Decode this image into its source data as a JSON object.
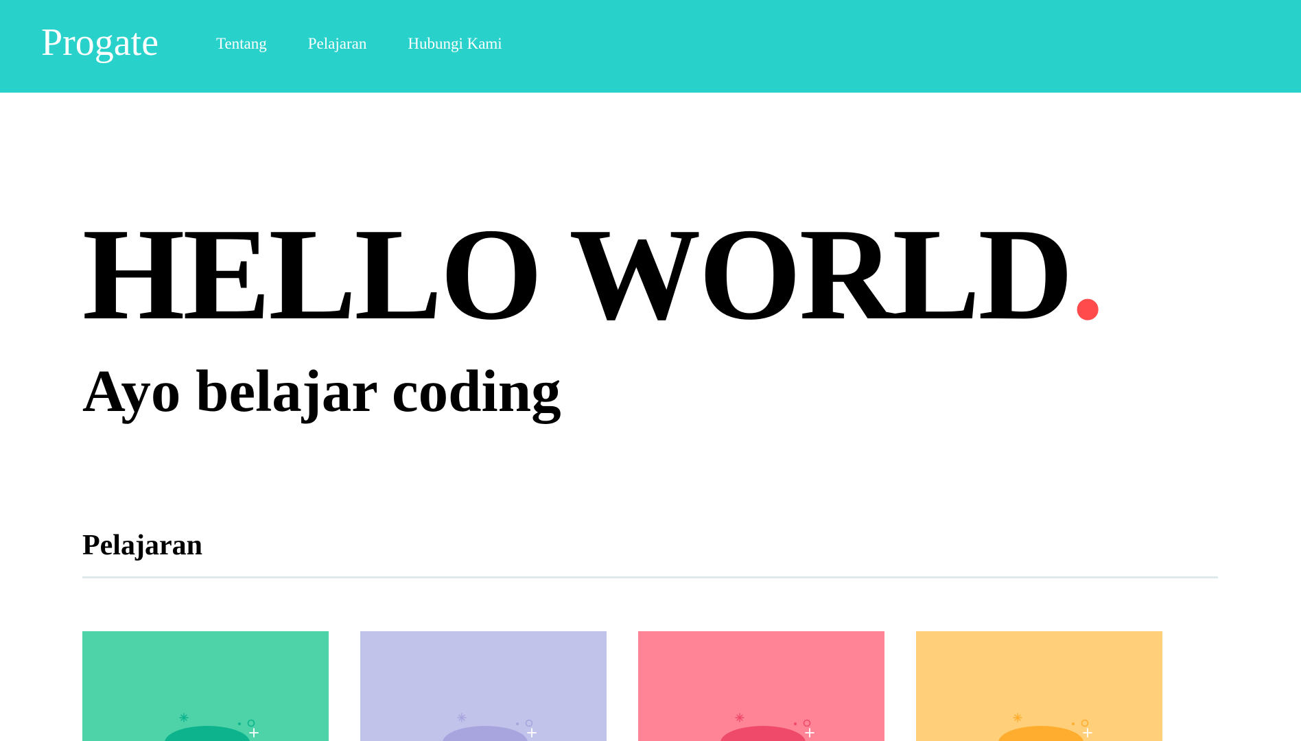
{
  "header": {
    "logo": "Progate",
    "nav": [
      {
        "label": "Tentang"
      },
      {
        "label": "Pelajaran"
      },
      {
        "label": "Hubungi Kami"
      }
    ]
  },
  "hero": {
    "title": "HELLO WORLD",
    "title_dot": ".",
    "subtitle": "Ayo belajar coding"
  },
  "lessons": {
    "heading": "Pelajaran",
    "cards": [
      {
        "background": "#4ed3a9",
        "accent": "#0cb38d",
        "icon": "lesson-illustration"
      },
      {
        "background": "#c1c3eb",
        "accent": "#a8a4dd",
        "icon": "lesson-illustration"
      },
      {
        "background": "#ff8596",
        "accent": "#f04a6a",
        "icon": "lesson-illustration"
      },
      {
        "background": "#ffcf79",
        "accent": "#ffad2e",
        "icon": "lesson-illustration"
      }
    ]
  },
  "colors": {
    "header": "#29d1cb",
    "accent_dot": "#ff4b4b",
    "divider": "#dfe8ea"
  }
}
